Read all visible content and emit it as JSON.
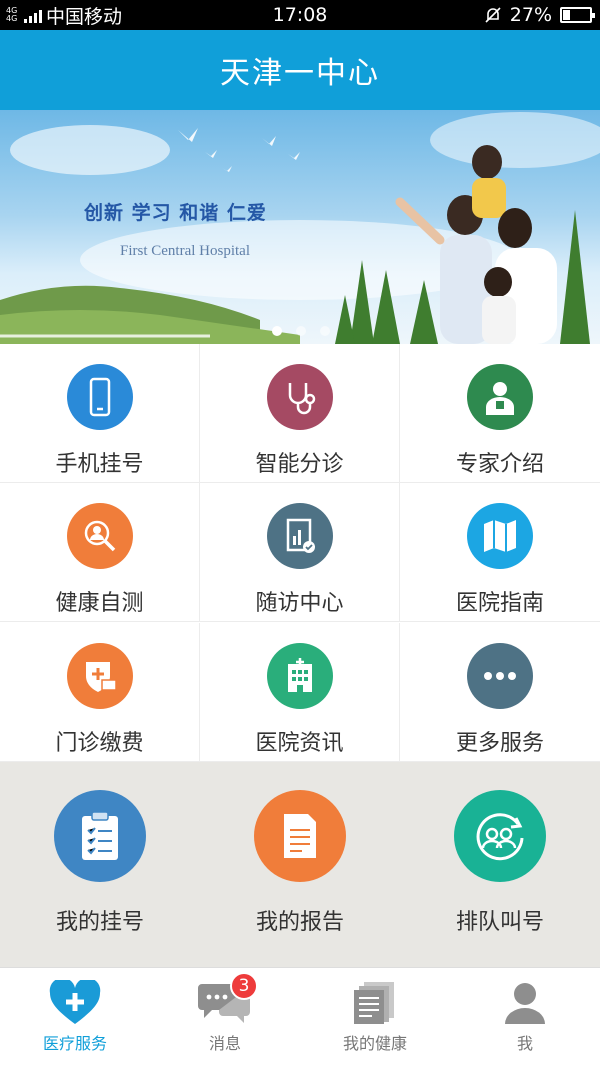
{
  "status_bar": {
    "network": "4G 4G",
    "carrier": "中国移动",
    "time": "17:08",
    "battery": "27%",
    "battery_level": 0.27
  },
  "header": {
    "title": "天津一中心"
  },
  "banner": {
    "slogan": "创新  学习  和谐  仁爱",
    "english_name": "First Central Hospital",
    "carousel_pages": 3,
    "carousel_active_index": 0
  },
  "services": [
    {
      "label": "手机挂号",
      "icon": "phone-icon",
      "color": "#2a8ad8"
    },
    {
      "label": "智能分诊",
      "icon": "stethoscope-icon",
      "color": "#a54a63"
    },
    {
      "label": "专家介绍",
      "icon": "doctor-icon",
      "color": "#2e8a4f"
    },
    {
      "label": "健康自测",
      "icon": "search-person-icon",
      "color": "#f07d3a"
    },
    {
      "label": "随访中心",
      "icon": "report-chart-icon",
      "color": "#4e7285"
    },
    {
      "label": "医院指南",
      "icon": "map-icon",
      "color": "#1ca6e3"
    },
    {
      "label": "门诊缴费",
      "icon": "payment-icon",
      "color": "#f07d3a"
    },
    {
      "label": "医院资讯",
      "icon": "hospital-building-icon",
      "color": "#2aae7b"
    },
    {
      "label": "更多服务",
      "icon": "more-icon",
      "color": "#4e7285"
    }
  ],
  "quick_actions": [
    {
      "label": "我的挂号",
      "icon": "clipboard-icon",
      "color": "#3f86c4"
    },
    {
      "label": "我的报告",
      "icon": "document-icon",
      "color": "#f07d3a"
    },
    {
      "label": "排队叫号",
      "icon": "queue-icon",
      "color": "#19b295"
    }
  ],
  "tab_bar": {
    "tabs": [
      {
        "label": "医疗服务",
        "icon": "heart-plus-icon",
        "active": true
      },
      {
        "label": "消息",
        "icon": "chat-icon",
        "badge": "3"
      },
      {
        "label": "我的健康",
        "icon": "documents-icon"
      },
      {
        "label": "我",
        "icon": "person-icon"
      }
    ]
  },
  "colors": {
    "primary": "#109fd9",
    "badge": "#ee3b3b",
    "quick_bg": "#e8e7e3"
  }
}
